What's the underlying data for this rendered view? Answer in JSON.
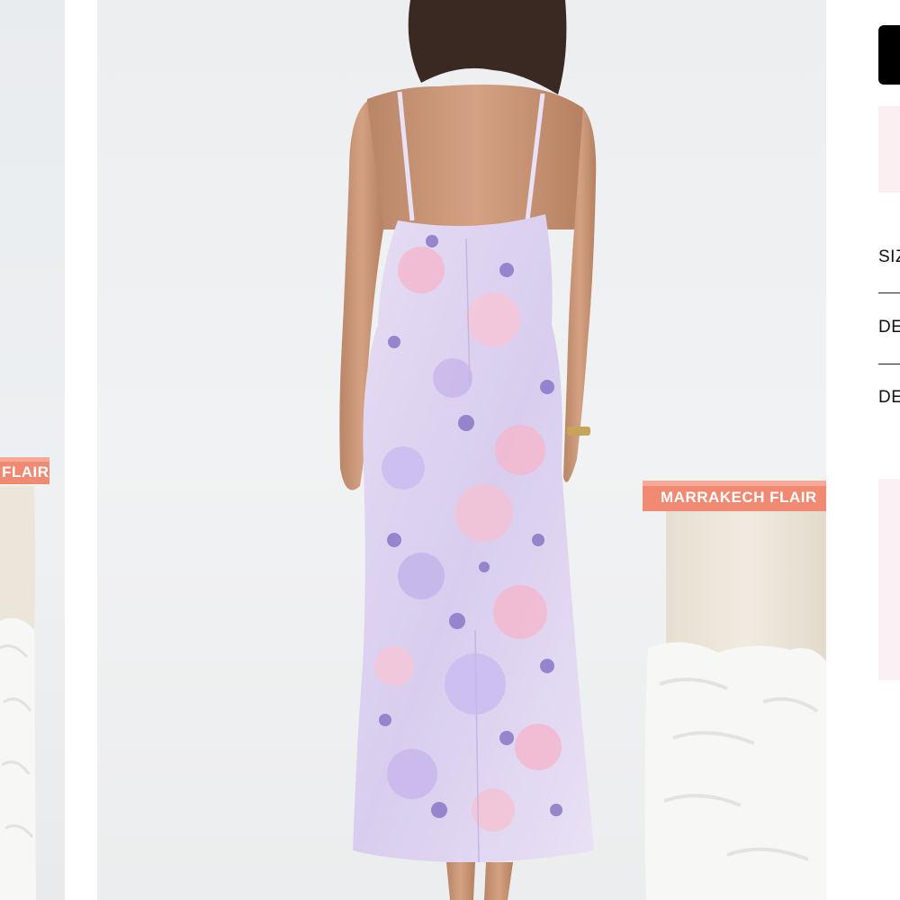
{
  "gallery": {
    "main_image_alt": "",
    "book_spine_text_main": "MARRAKECH FLAIR",
    "book_spine_text_thumb": "FLAIR",
    "colors": {
      "wall": "#eceef0",
      "dress_base": "#dcd2f0",
      "dress_pink": "#f3b9cf",
      "dress_purple": "#8e7cc8",
      "book": "#f08a72",
      "plinth": "#ece6da"
    }
  },
  "panel": {
    "add_to_bag_label": "",
    "accordion": [
      {
        "label": "SIZ"
      },
      {
        "label": "DE"
      },
      {
        "label": "DE"
      }
    ]
  }
}
